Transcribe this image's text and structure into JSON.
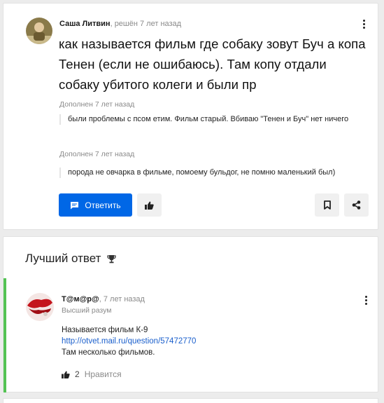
{
  "question": {
    "author": "Саша Литвин",
    "meta": ", решён 7 лет назад",
    "title": "как называется фильм где собаку зовут Буч а копа Тенен (если не ошибаюсь). Там копу отдали собаку убитого колеги и были пр",
    "additions": [
      {
        "label": "Дополнен 7 лет назад",
        "text": "были проблемы с псом етим. Фильм старый. Вбиваю \"Тенен и Буч\" нет ничего"
      },
      {
        "label": "Дополнен 7 лет назад",
        "text": "порода не овчарка в фильме, помоему бульдог, не помню маленький был)"
      }
    ],
    "reply_label": "Ответить"
  },
  "best_answer": {
    "header": "Лучший ответ",
    "author": "Т@м@р@",
    "meta": ", 7 лет назад",
    "rank": "Высший разум",
    "lines": [
      "Называется фильм К-9",
      "http://otvet.mail.ru/question/57472770",
      "Там несколько фильмов."
    ],
    "likes_count": "2",
    "likes_label": "Нравится"
  },
  "colors": {
    "accent": "#0067e6",
    "best_border": "#53c353",
    "link": "#1a5fcc"
  },
  "icons": [
    "chat-icon",
    "thumb-up-icon",
    "bookmark-icon",
    "share-icon",
    "trophy-icon",
    "more-vertical-icon"
  ]
}
